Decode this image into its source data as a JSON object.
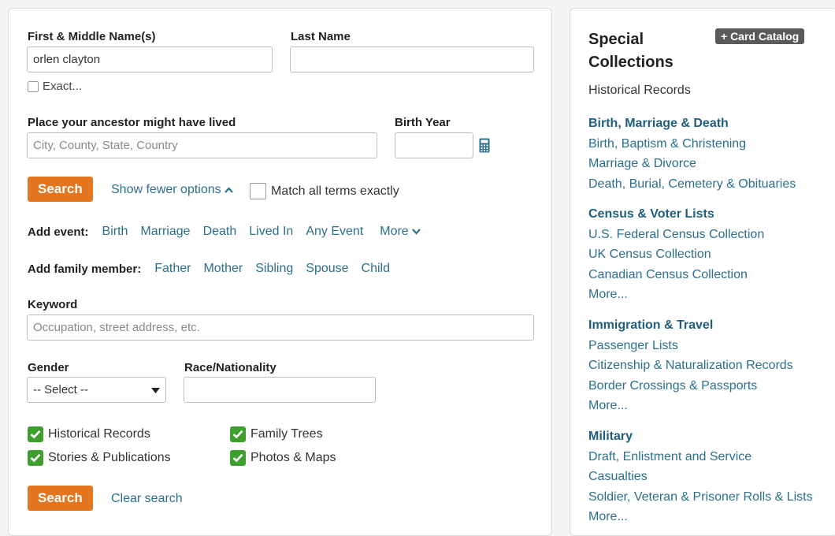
{
  "form": {
    "first_name_label": "First & Middle Name(s)",
    "first_name_value": "orlen clayton",
    "last_name_label": "Last Name",
    "last_name_value": "",
    "exact_label": "Exact...",
    "place_label": "Place your ancestor might have lived",
    "place_placeholder": "City, County, State, Country",
    "birth_year_label": "Birth Year",
    "birth_year_value": "",
    "search_button": "Search",
    "show_fewer_label": "Show fewer options",
    "match_all_label": "Match all terms exactly",
    "add_event_label": "Add event:",
    "events": [
      "Birth",
      "Marriage",
      "Death",
      "Lived In",
      "Any Event",
      "More"
    ],
    "add_family_label": "Add family member:",
    "family": [
      "Father",
      "Mother",
      "Sibling",
      "Spouse",
      "Child"
    ],
    "keyword_label": "Keyword",
    "keyword_placeholder": "Occupation, street address, etc.",
    "gender_label": "Gender",
    "gender_selected": "-- Select --",
    "race_label": "Race/Nationality",
    "race_value": "",
    "types": [
      {
        "label": "Historical Records",
        "checked": true
      },
      {
        "label": "Family Trees",
        "checked": true
      },
      {
        "label": "Stories & Publications",
        "checked": true
      },
      {
        "label": "Photos & Maps",
        "checked": true
      }
    ],
    "clear_search": "Clear search"
  },
  "sidebar": {
    "title_line1": "Special",
    "title_line2": "Collections",
    "card_catalog": "+ Card Catalog",
    "subtitle": "Historical Records",
    "categories": [
      {
        "heading": "Birth, Marriage & Death",
        "links": [
          "Birth, Baptism & Christening",
          "Marriage & Divorce",
          "Death, Burial, Cemetery & Obituaries"
        ]
      },
      {
        "heading": "Census & Voter Lists",
        "links": [
          "U.S. Federal Census Collection",
          "UK Census Collection",
          "Canadian Census Collection",
          "More..."
        ]
      },
      {
        "heading": "Immigration & Travel",
        "links": [
          "Passenger Lists",
          "Citizenship & Naturalization Records",
          "Border Crossings & Passports",
          "More..."
        ]
      },
      {
        "heading": "Military",
        "links": [
          "Draft, Enlistment and Service",
          "Casualties",
          "Soldier, Veteran & Prisoner Rolls & Lists",
          "More..."
        ]
      }
    ]
  },
  "colors": {
    "search_button": "#e3761e",
    "link": "#2c6f8d",
    "check_green": "#3e9e2e",
    "card_catalog_bg": "#5a5a5a"
  }
}
